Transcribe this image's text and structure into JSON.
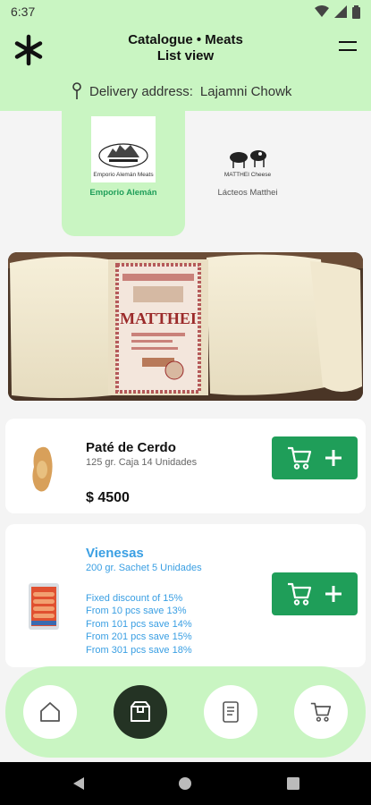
{
  "status_bar": {
    "time": "6:37"
  },
  "header": {
    "title_line1": "Catalogue • Meats",
    "title_line2": "List view",
    "delivery_label": "Delivery address:",
    "delivery_value": "Lajamni Chowk"
  },
  "brands": [
    {
      "name": "Emporio Alemán",
      "logo_caption": "Emporio Alemán Meats",
      "selected": true
    },
    {
      "name": "Lácteos Matthei",
      "logo_caption": "MATTHEI Cheese",
      "selected": false
    }
  ],
  "banner": {
    "label_brand": "MATTHEI"
  },
  "products": [
    {
      "name": "Paté de Cerdo",
      "subtitle": "125 gr. Caja 14 Unidades",
      "price": "$ 4500"
    },
    {
      "name": "Vienesas",
      "subtitle": "200 gr. Sachet 5 Unidades",
      "discounts": [
        "Fixed discount of 15%",
        "From 10 pcs save 13%",
        "From 101 pcs save 14%",
        "From 201 pcs save 15%",
        "From 301 pcs save 18%"
      ]
    }
  ],
  "bottom_nav": [
    {
      "icon": "home-icon",
      "active": false
    },
    {
      "icon": "catalogue-icon",
      "active": true
    },
    {
      "icon": "orders-icon",
      "active": false
    },
    {
      "icon": "cart-icon",
      "active": false
    }
  ],
  "colors": {
    "accent": "#c9f5c2",
    "button": "#1f9e59",
    "link": "#3a9fe3",
    "selected_brand": "#1f9e59"
  }
}
